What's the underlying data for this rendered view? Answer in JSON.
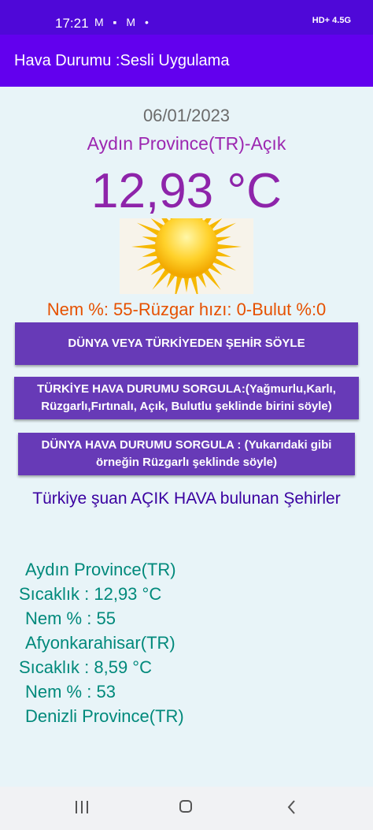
{
  "status_bar": {
    "time": "17:21",
    "left_icons": "M ▪ M •",
    "right_text": "HD+ 4.5G"
  },
  "app": {
    "title": "Hava Durumu :Sesli Uygulama"
  },
  "weather": {
    "date": "06/01/2023",
    "location": "Aydın Province(TR)-Açık",
    "temperature": "12,93 °C",
    "details": "Nem %: 55-Rüzgar hızı: 0-Bulut %:0"
  },
  "buttons": {
    "say_city": "DÜNYA VEYA TÜRKİYEDEN ŞEHİR SÖYLE",
    "turkey_query": "TÜRKİYE HAVA DURUMU SORGULA:(Yağmurlu,Karlı, Rüzgarlı,Fırtınalı, Açık, Bulutlu şeklinde birini söyle)",
    "world_query": "DÜNYA HAVA DURUMU SORGULA : (Yukarıdaki gibi örneğin Rüzgarlı şeklinde söyle)"
  },
  "results": {
    "heading": "Türkiye şuan AÇIK HAVA bulunan Şehirler",
    "lines": [
      "Aydın Province(TR)",
      "Sıcaklık : 12,93 °C",
      "Nem % : 55",
      "Afyonkarahisar(TR)",
      "Sıcaklık : 8,59 °C",
      "Nem % : 53",
      "Denizli Province(TR)"
    ]
  },
  "colors": {
    "status_bar": "#4f08d8",
    "app_bar": "#6200ee",
    "button": "#673ab7",
    "background": "#e8f4f8",
    "location": "#9c27b0",
    "temperature": "#8e24aa",
    "details": "#e65100",
    "result_text": "#00897b"
  },
  "icons": {
    "weather": "sun-icon",
    "nav": [
      "recent-apps-icon",
      "home-icon",
      "back-icon"
    ]
  }
}
